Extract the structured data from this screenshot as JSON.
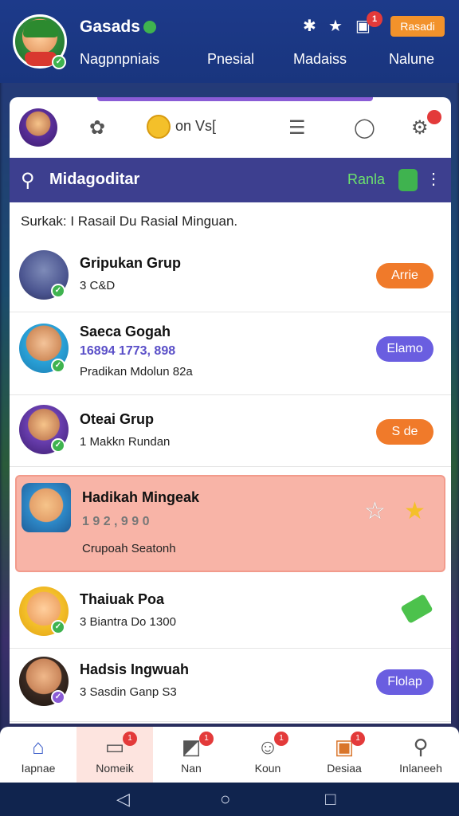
{
  "header": {
    "title": "Gasads",
    "tabs": [
      "Nagpnpniais",
      "Pnesial",
      "Madaiss",
      "Nalune"
    ],
    "chip_label": "Rasadi",
    "notif_count": "1"
  },
  "toolbar": {
    "coin_text": "on Vs[",
    "notif_badge": ""
  },
  "search": {
    "title": "Midagoditar",
    "right_label": "Ranla"
  },
  "subtitle": "Surkak: I Rasail Du Rasial Minguan.",
  "rows": [
    {
      "title": "Gripukan Grup",
      "meta": "3  C&D",
      "button": "Arrie"
    },
    {
      "title": "Saeca Gogah",
      "sub": "16894 1773, 898",
      "meta": "Pradikan Mdolun 82a",
      "button": "Elamo"
    },
    {
      "title": "Oteai Grup",
      "meta": "1  Makkn Rundan",
      "button": "S de"
    },
    {
      "title": "Hadikah Mingeak",
      "sub": "1 9 2 ,  9 9 0",
      "meta": "Crupoah Seatonh"
    },
    {
      "title": "Thaiuak Poa",
      "meta": "3  Biantra Do 1300"
    },
    {
      "title": "Hadsis Ingwuah",
      "meta": "3  Sasdin Ganp  S3",
      "button": "Flolap"
    }
  ],
  "bottomnav": [
    {
      "label": "Iapnae",
      "icon": "home-icon"
    },
    {
      "label": "Nomeik",
      "icon": "notes-icon",
      "badge": "1"
    },
    {
      "label": "Nan",
      "icon": "board-icon",
      "badge": "1"
    },
    {
      "label": "Koun",
      "icon": "chat-icon",
      "badge": "1"
    },
    {
      "label": "Desiaa",
      "icon": "chest-icon",
      "badge": "1"
    },
    {
      "label": "Inlaneeh",
      "icon": "search-icon"
    }
  ],
  "colors": {
    "header": "#1d3a8a",
    "accent_orange": "#f07a2a",
    "accent_purple": "#6a5ee0",
    "highlight": "#f8b4a7"
  }
}
